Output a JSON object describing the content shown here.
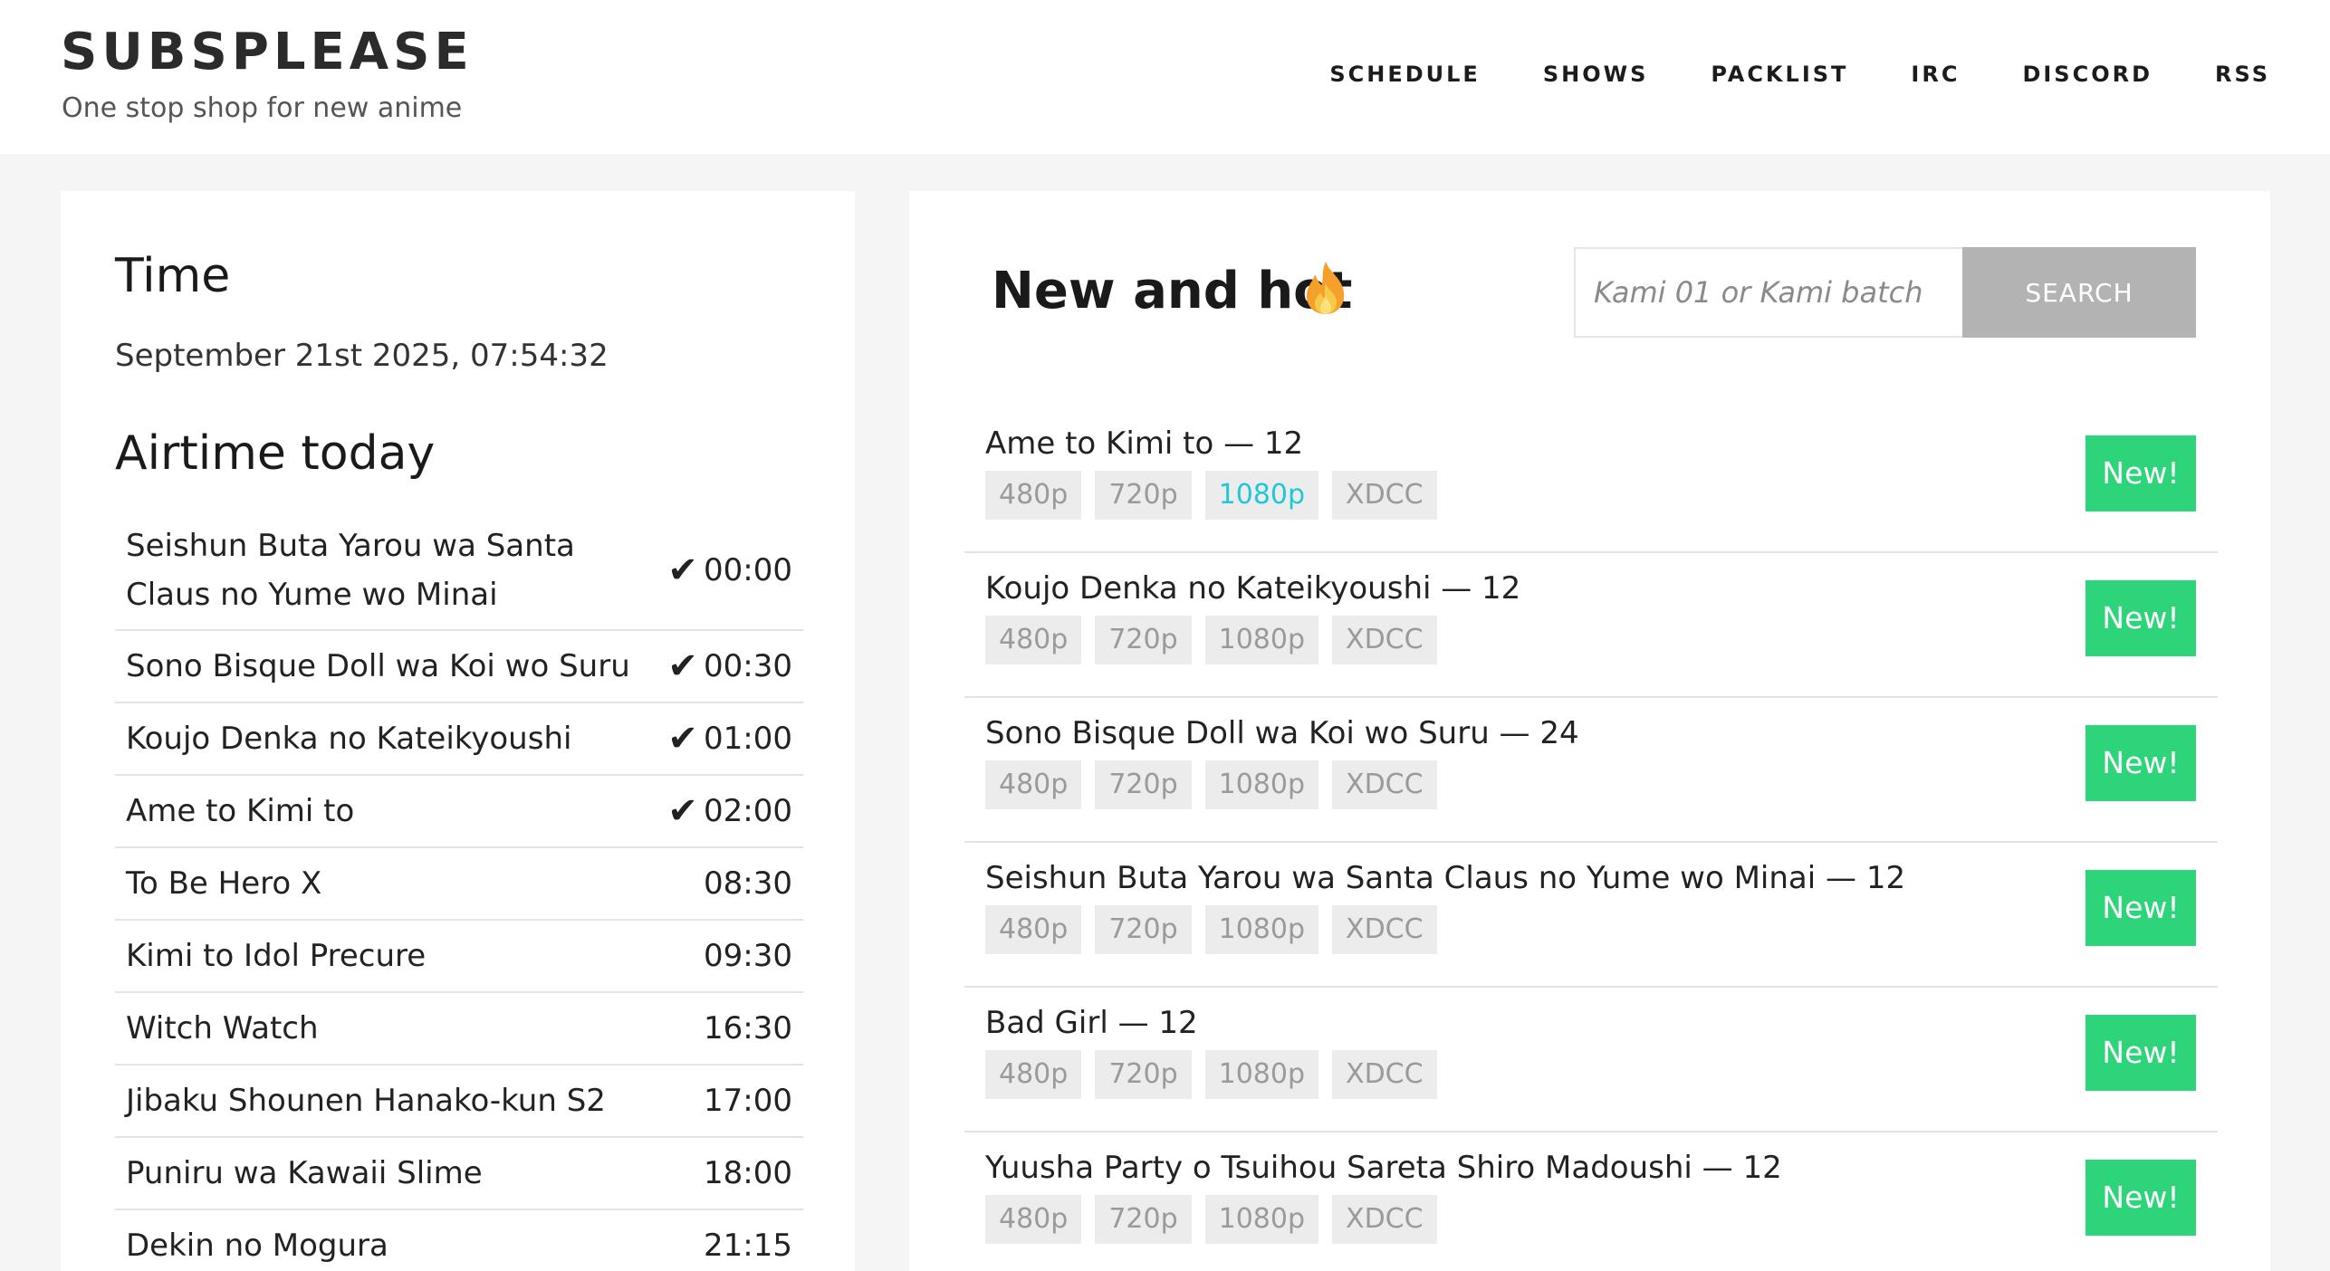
{
  "header": {
    "title": "SUBSPLEASE",
    "tagline": "One stop shop for new anime",
    "nav": [
      "SCHEDULE",
      "SHOWS",
      "PACKLIST",
      "IRC",
      "DISCORD",
      "RSS"
    ]
  },
  "time_section": {
    "heading": "Time",
    "value": "September 21st 2025, 07:54:32"
  },
  "airtime": {
    "heading": "Airtime today",
    "items": [
      {
        "name": "Seishun Buta Yarou wa Santa Claus no Yume wo Minai",
        "aired": true,
        "check": "✔",
        "time": "00:00"
      },
      {
        "name": "Sono Bisque Doll wa Koi wo Suru",
        "aired": true,
        "check": "✔",
        "time": "00:30"
      },
      {
        "name": "Koujo Denka no Kateikyoushi",
        "aired": true,
        "check": "✔",
        "time": "01:00"
      },
      {
        "name": "Ame to Kimi to",
        "aired": true,
        "check": "✔",
        "time": "02:00"
      },
      {
        "name": "To Be Hero X",
        "aired": false,
        "check": "",
        "time": "08:30"
      },
      {
        "name": "Kimi to Idol Precure",
        "aired": false,
        "check": "",
        "time": "09:30"
      },
      {
        "name": "Witch Watch",
        "aired": false,
        "check": "",
        "time": "16:30"
      },
      {
        "name": "Jibaku Shounen Hanako-kun S2",
        "aired": false,
        "check": "",
        "time": "17:00"
      },
      {
        "name": "Puniru wa Kawaii Slime",
        "aired": false,
        "check": "",
        "time": "18:00"
      },
      {
        "name": "Dekin no Mogura",
        "aired": false,
        "check": "",
        "time": "21:15"
      }
    ]
  },
  "new_and_hot": {
    "heading": "New and hot",
    "icon": "fire-icon",
    "search_placeholder": "Kami 01 or Kami batch",
    "search_label": "SEARCH",
    "badge_label": "New!",
    "qualities": [
      "480p",
      "720p",
      "1080p",
      "XDCC"
    ],
    "releases": [
      {
        "title": "Ame to Kimi to — 12",
        "highlighted_quality": "1080p"
      },
      {
        "title": "Koujo Denka no Kateikyoushi — 12",
        "highlighted_quality": ""
      },
      {
        "title": "Sono Bisque Doll wa Koi wo Suru — 24",
        "highlighted_quality": ""
      },
      {
        "title": "Seishun Buta Yarou wa Santa Claus no Yume wo Minai — 12",
        "highlighted_quality": ""
      },
      {
        "title": "Bad Girl — 12",
        "highlighted_quality": ""
      },
      {
        "title": "Yuusha Party o Tsuihou Sareta Shiro Madoushi — 12",
        "highlighted_quality": ""
      }
    ]
  },
  "colors": {
    "badge_green": "#2ed47a",
    "active_quality": "#20c7d6",
    "search_button": "#b3b3b3",
    "page_background": "#f5f5f5"
  }
}
